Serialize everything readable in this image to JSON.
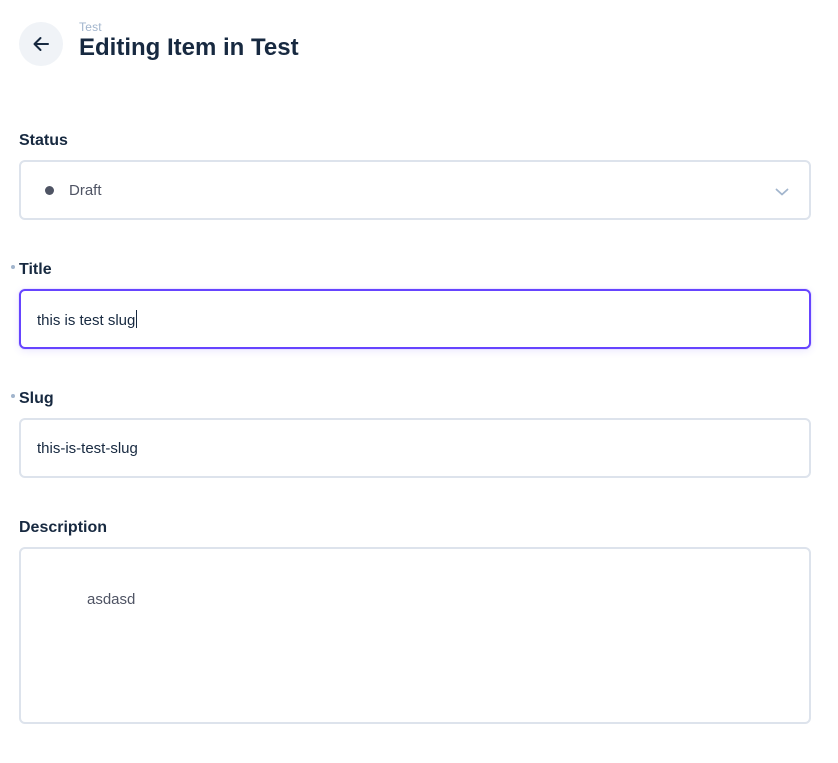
{
  "header": {
    "breadcrumb": "Test",
    "title": "Editing Item in Test",
    "back_icon": "arrow-left-icon"
  },
  "fields": {
    "status": {
      "label": "Status",
      "value": "Draft",
      "dot_color": "#4f5464",
      "icon": "chevron-down-icon"
    },
    "title": {
      "label": "Title",
      "required": true,
      "value": "this is test slug",
      "focus_color": "#6644ff"
    },
    "slug": {
      "label": "Slug",
      "required": true,
      "value": "this-is-test-slug"
    },
    "description": {
      "label": "Description",
      "value": "asdasd"
    }
  }
}
